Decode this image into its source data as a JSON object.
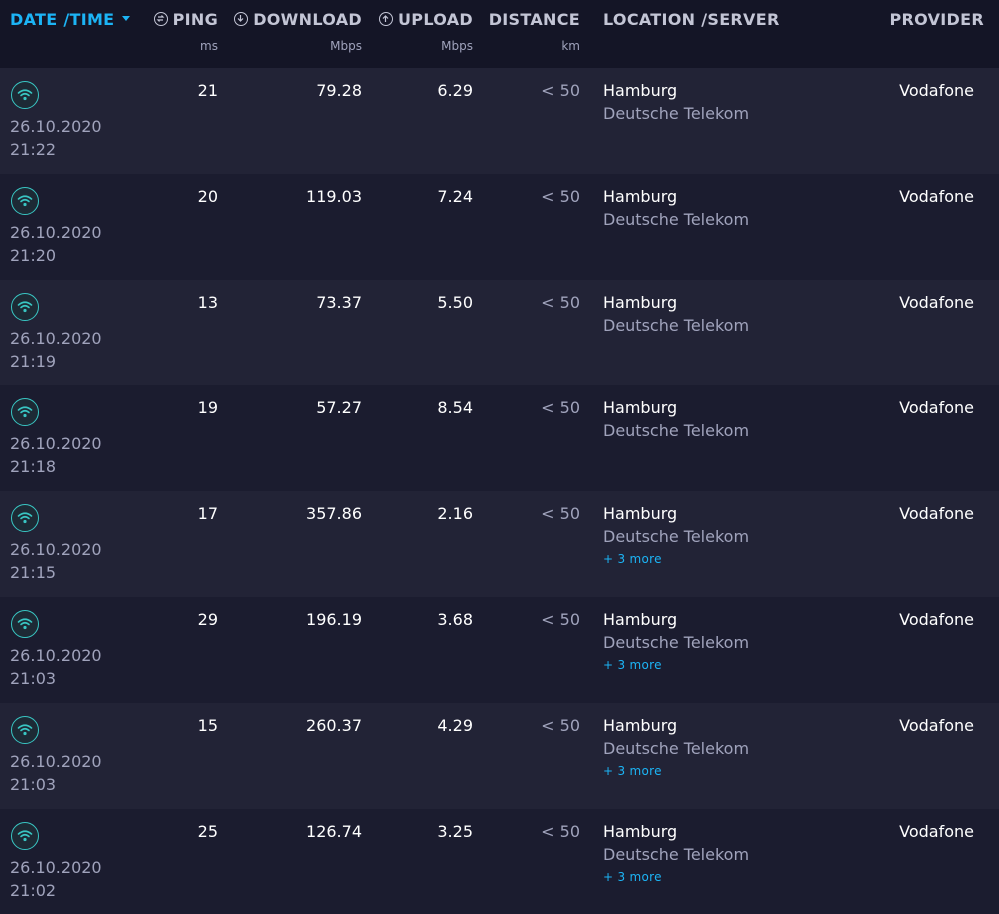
{
  "header": {
    "datetime": "DATE /TIME",
    "ping": "PING",
    "ping_unit": "ms",
    "download": "DOWNLOAD",
    "download_unit": "Mbps",
    "upload": "UPLOAD",
    "upload_unit": "Mbps",
    "distance": "DISTANCE",
    "distance_unit": "km",
    "location": "LOCATION /SERVER",
    "provider": "PROVIDER"
  },
  "colors": {
    "accent": "#1cb4f5",
    "wifi_icon": "#39c6c3",
    "background": "#1a1b2e"
  },
  "rows": [
    {
      "date": "26.10.2020",
      "time": "21:22",
      "ping": "21",
      "download": "79.28",
      "upload": "6.29",
      "distance": "< 50",
      "location": "Hamburg",
      "server": "Deutsche Telekom",
      "more": "",
      "provider": "Vodafone"
    },
    {
      "date": "26.10.2020",
      "time": "21:20",
      "ping": "20",
      "download": "119.03",
      "upload": "7.24",
      "distance": "< 50",
      "location": "Hamburg",
      "server": "Deutsche Telekom",
      "more": "",
      "provider": "Vodafone"
    },
    {
      "date": "26.10.2020",
      "time": "21:19",
      "ping": "13",
      "download": "73.37",
      "upload": "5.50",
      "distance": "< 50",
      "location": "Hamburg",
      "server": "Deutsche Telekom",
      "more": "",
      "provider": "Vodafone"
    },
    {
      "date": "26.10.2020",
      "time": "21:18",
      "ping": "19",
      "download": "57.27",
      "upload": "8.54",
      "distance": "< 50",
      "location": "Hamburg",
      "server": "Deutsche Telekom",
      "more": "",
      "provider": "Vodafone"
    },
    {
      "date": "26.10.2020",
      "time": "21:15",
      "ping": "17",
      "download": "357.86",
      "upload": "2.16",
      "distance": "< 50",
      "location": "Hamburg",
      "server": "Deutsche Telekom",
      "more": "+ 3 more",
      "provider": "Vodafone"
    },
    {
      "date": "26.10.2020",
      "time": "21:03",
      "ping": "29",
      "download": "196.19",
      "upload": "3.68",
      "distance": "< 50",
      "location": "Hamburg",
      "server": "Deutsche Telekom",
      "more": "+ 3 more",
      "provider": "Vodafone"
    },
    {
      "date": "26.10.2020",
      "time": "21:03",
      "ping": "15",
      "download": "260.37",
      "upload": "4.29",
      "distance": "< 50",
      "location": "Hamburg",
      "server": "Deutsche Telekom",
      "more": "+ 3 more",
      "provider": "Vodafone"
    },
    {
      "date": "26.10.2020",
      "time": "21:02",
      "ping": "25",
      "download": "126.74",
      "upload": "3.25",
      "distance": "< 50",
      "location": "Hamburg",
      "server": "Deutsche Telekom",
      "more": "+ 3 more",
      "provider": "Vodafone"
    }
  ]
}
